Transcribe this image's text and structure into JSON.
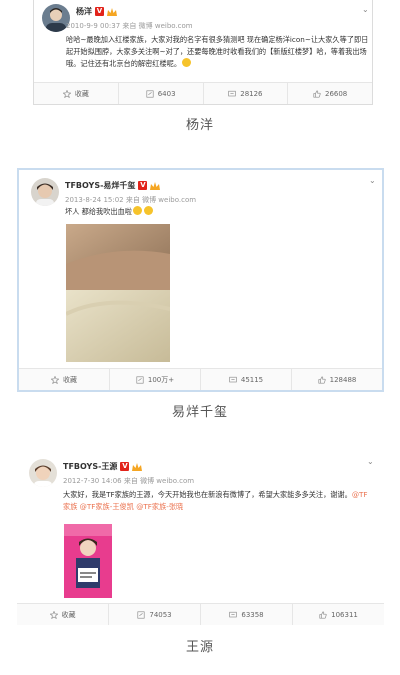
{
  "posts": [
    {
      "username": "杨洋",
      "timestamp": "2010-9-9 00:37 来自 微博 weibo.com",
      "text": "哈哈~最晚加入红楼家族，大家对我的名字有很多猜测吧 现在确定杨洋icon~让大家久等了即日起开始拟围脖，大家多关注啊~对了，还要每晚准时收看我们的【新版红楼梦】哈，等着我出场哦。记住还有北京台的解密红楼呢。",
      "actions": {
        "favorite": "收藏",
        "repost": "6403",
        "comment": "28126",
        "like": "26608"
      },
      "caption": "杨洋"
    },
    {
      "username": "TFBOYS-易烊千玺",
      "timestamp": "2013-8-24 15:02 来自 微博 weibo.com",
      "text": "坏人 都给我吹出血啦",
      "actions": {
        "favorite": "收藏",
        "repost": "100万+",
        "comment": "45115",
        "like": "128488"
      },
      "caption": "易烊千玺"
    },
    {
      "username": "TFBOYS-王源",
      "timestamp": "2012-7-30 14:06 来自 微博 weibo.com",
      "text": "大家好，我是TF家族的王源，今天开始我也在新浪有微博了，希望大家能多多关注，谢谢。",
      "mentions": "@TF家族 @TF家族-王俊凯 @TF家族-张晓",
      "actions": {
        "favorite": "收藏",
        "repost": "74053",
        "comment": "63358",
        "like": "106311"
      },
      "caption": "王源"
    }
  ],
  "colors": {
    "accent": "#eb7350",
    "vip": "#e2231a",
    "highlight_border": "#c9dcef"
  }
}
